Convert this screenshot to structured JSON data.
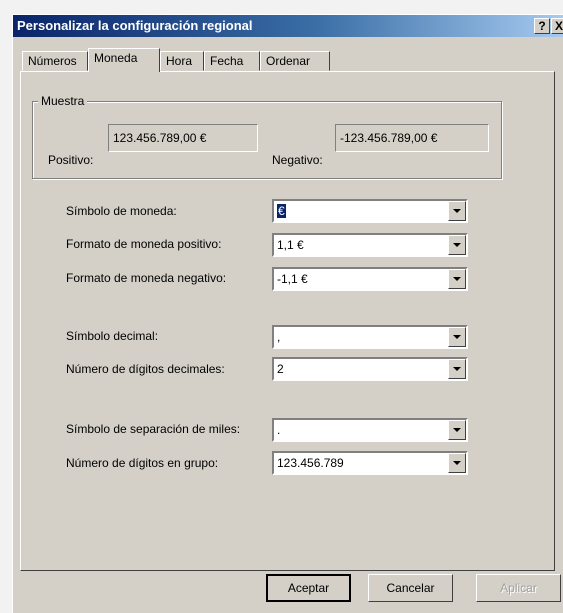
{
  "window": {
    "title": "Personalizar la configuración regional",
    "help_btn": "?",
    "close_btn": "X"
  },
  "tabs": [
    "Números",
    "Moneda",
    "Hora",
    "Fecha",
    "Ordenar"
  ],
  "active_tab": "Moneda",
  "sample": {
    "group_label": "Muestra",
    "positive_label": "Positivo:",
    "positive_value": "123.456.789,00 €",
    "negative_label": "Negativo:",
    "negative_value": "-123.456.789,00 €"
  },
  "fields": {
    "currency_symbol": {
      "label": "Símbolo de moneda:",
      "value": "€"
    },
    "positive_format": {
      "label": "Formato de moneda positivo:",
      "value": "1,1 €"
    },
    "negative_format": {
      "label": "Formato de moneda negativo:",
      "value": "-1,1 €"
    },
    "decimal_symbol": {
      "label": "Símbolo decimal:",
      "value": ","
    },
    "decimal_digits": {
      "label": "Número de dígitos decimales:",
      "value": "2"
    },
    "thousands_symbol": {
      "label": "Símbolo de separación de miles:",
      "value": "."
    },
    "grouping_digits": {
      "label": "Número de dígitos en grupo:",
      "value": "123.456.789"
    }
  },
  "buttons": {
    "ok": "Aceptar",
    "cancel": "Cancelar",
    "apply": "Aplicar"
  }
}
